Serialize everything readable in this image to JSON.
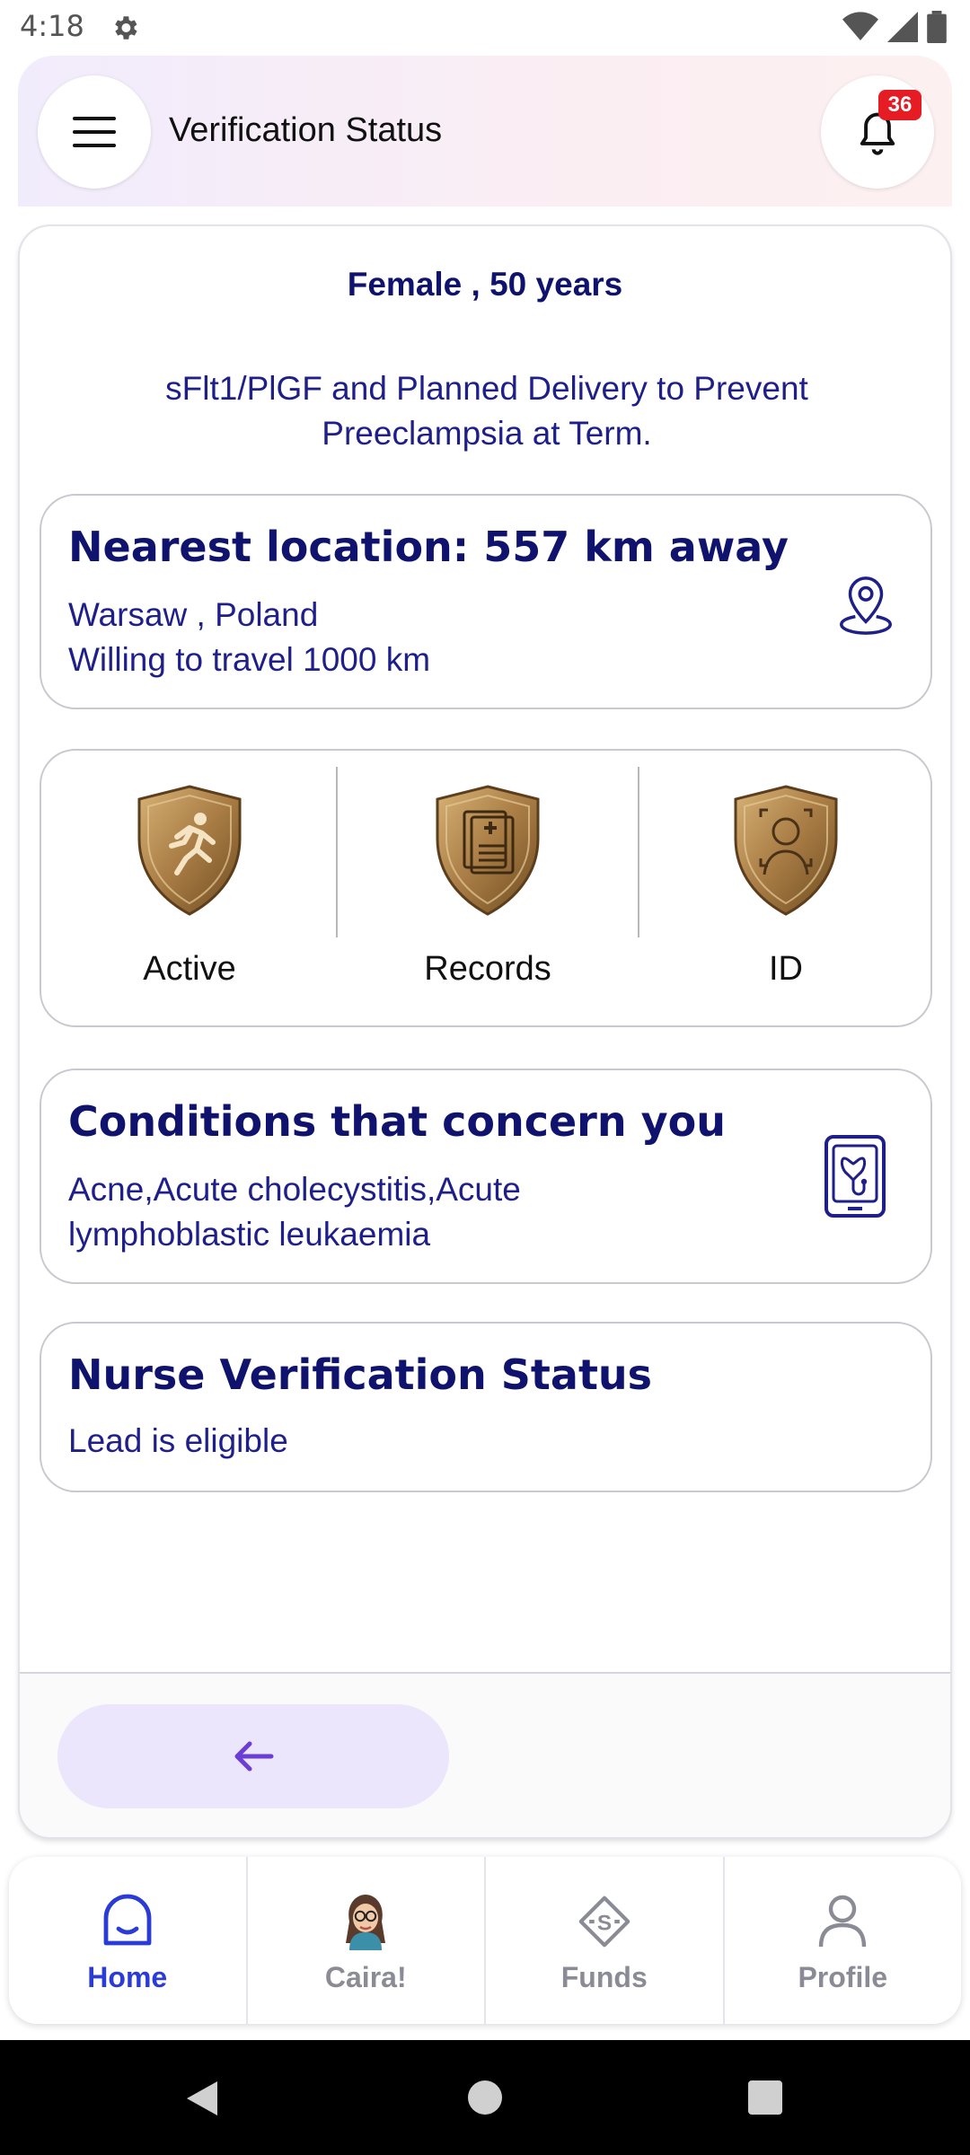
{
  "status_bar": {
    "time": "4:18"
  },
  "header": {
    "title": "Verification Status",
    "notification_count": "36"
  },
  "summary": {
    "demographic": "Female , 50  years",
    "study_title": "sFlt1/PlGF and Planned Delivery to Prevent Preeclampsia at Term."
  },
  "location": {
    "heading": "Nearest location: 557 km away",
    "city": "Warsaw , Poland",
    "travel": "Willing to travel  1000 km"
  },
  "badges": [
    {
      "label": "Active",
      "icon": "runner-shield-icon"
    },
    {
      "label": "Records",
      "icon": "records-shield-icon"
    },
    {
      "label": "ID",
      "icon": "id-shield-icon"
    }
  ],
  "conditions": {
    "heading": "Conditions that concern you",
    "list": "Acne,Acute cholecystitis,Acute lymphoblastic leukaemia"
  },
  "nurse": {
    "heading": "Nurse Verification Status",
    "status": "Lead is eligible"
  },
  "bottom_nav": [
    {
      "label": "Home",
      "icon": "home-icon",
      "active": true
    },
    {
      "label": "Caira!",
      "icon": "caira-avatar-icon",
      "active": false
    },
    {
      "label": "Funds",
      "icon": "funds-icon",
      "active": false
    },
    {
      "label": "Profile",
      "icon": "profile-icon",
      "active": false
    }
  ],
  "colors": {
    "primary_text": "#10136e",
    "accent": "#2a3bd6",
    "badge_red": "#e51c23",
    "back_button_bg": "#ebe6fb",
    "shield_gold": "#a07a45"
  }
}
